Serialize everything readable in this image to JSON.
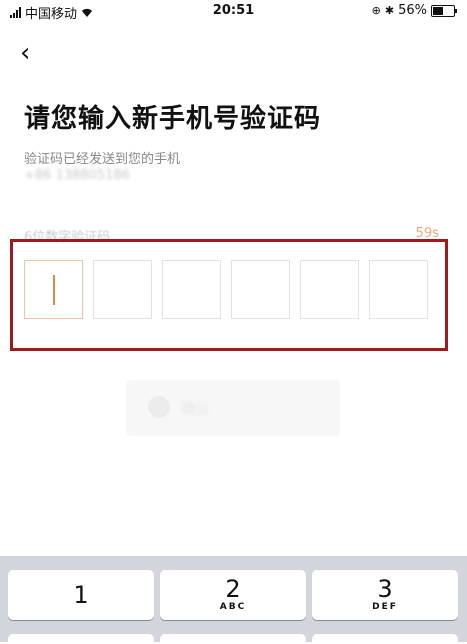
{
  "status_bar": {
    "carrier": "中国移动",
    "time": "20:51",
    "battery_percent": "56%",
    "battery_level": 0.56
  },
  "header": {
    "back_icon": "‹",
    "title": "请您输入新手机号验证码"
  },
  "info": {
    "sent_text": "验证码已经发送到您的手机",
    "phone_masked": "+86 138805186"
  },
  "code": {
    "label": "6位数字验证码",
    "countdown": "59s",
    "length": 6
  },
  "confirm_button": {
    "label": "确认"
  },
  "keyboard": {
    "keys": [
      {
        "num": "1",
        "letters": ""
      },
      {
        "num": "2",
        "letters": "ABC"
      },
      {
        "num": "3",
        "letters": "DEF"
      }
    ]
  }
}
